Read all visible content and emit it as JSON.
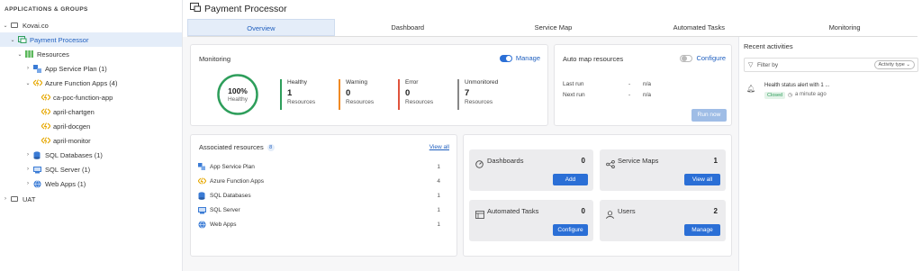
{
  "sidebar": {
    "title": "APPLICATIONS & GROUPS",
    "tree": [
      {
        "label": "Kovai.co"
      },
      {
        "label": "Payment Processor"
      },
      {
        "label": "Resources"
      },
      {
        "label": "App Service Plan (1)"
      },
      {
        "label": "Azure Function Apps (4)"
      },
      {
        "label": "ca-poc-function-app"
      },
      {
        "label": "april-chartgen"
      },
      {
        "label": "april-docgen"
      },
      {
        "label": "april-monitor"
      },
      {
        "label": "SQL Databases (1)"
      },
      {
        "label": "SQL Server (1)"
      },
      {
        "label": "Web Apps (1)"
      },
      {
        "label": "UAT"
      }
    ]
  },
  "page": {
    "title": "Payment Processor",
    "tabs": [
      {
        "label": "Overview"
      },
      {
        "label": "Dashboard"
      },
      {
        "label": "Service Map"
      },
      {
        "label": "Automated Tasks"
      },
      {
        "label": "Monitoring"
      }
    ]
  },
  "monitoring": {
    "title": "Monitoring",
    "manage_label": "Manage",
    "health_pct": "100%",
    "health_label": "Healthy",
    "stats": [
      {
        "label": "Healthy",
        "value": "1",
        "sub": "Resources",
        "color": "#2e9e5b"
      },
      {
        "label": "Warning",
        "value": "0",
        "sub": "Resources",
        "color": "#f08a24"
      },
      {
        "label": "Error",
        "value": "0",
        "sub": "Resources",
        "color": "#e0533d"
      },
      {
        "label": "Unmonitored",
        "value": "7",
        "sub": "Resources",
        "color": "#888888"
      }
    ]
  },
  "automap": {
    "title": "Auto map resources",
    "configure_label": "Configure",
    "last_run_label": "Last run",
    "last_run_sep": "-",
    "last_run_value": "n/a",
    "next_run_label": "Next run",
    "next_run_sep": "-",
    "next_run_value": "n/a",
    "run_now_label": "Run now"
  },
  "associated": {
    "title": "Associated resources",
    "count": "8",
    "view_all": "View all",
    "rows": [
      {
        "label": "App Service Plan",
        "count": "1"
      },
      {
        "label": "Azure Function Apps",
        "count": "4"
      },
      {
        "label": "SQL Databases",
        "count": "1"
      },
      {
        "label": "SQL Server",
        "count": "1"
      },
      {
        "label": "Web Apps",
        "count": "1"
      }
    ]
  },
  "tiles": [
    {
      "title": "Dashboards",
      "count": "0",
      "button": "Add"
    },
    {
      "title": "Service Maps",
      "count": "1",
      "button": "View all"
    },
    {
      "title": "Automated Tasks",
      "count": "0",
      "button": "Configure"
    },
    {
      "title": "Users",
      "count": "2",
      "button": "Manage"
    }
  ],
  "activities": {
    "title": "Recent activities",
    "filter_placeholder": "Filter by",
    "type_select": "Activity type",
    "items": [
      {
        "title": "Health status alert with 1 ...",
        "status": "Closed",
        "time": "a minute ago"
      }
    ]
  },
  "colors": {
    "accent": "#2b6fd6",
    "healthy": "#2e9e5b"
  }
}
